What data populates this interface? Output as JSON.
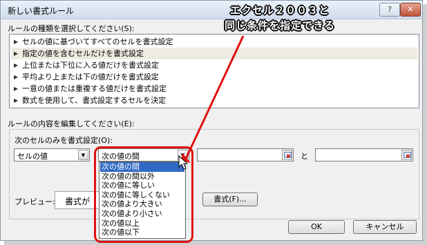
{
  "window": {
    "title": "新しい書式ルール",
    "help_btn": "?",
    "close_btn": "✕"
  },
  "rule_type": {
    "label": "ルールの種類を選択してください(S):",
    "items": [
      "セルの値に基づいてすべてのセルを書式設定",
      "指定の値を含むセルだけを書式設定",
      "上位または下位に入る値だけを書式設定",
      "平均より上または下の値だけを書式設定",
      "一意の値または重複する値だけを書式設定",
      "数式を使用して、書式設定するセルを決定"
    ],
    "selected_index": 1
  },
  "rule_edit": {
    "label": "ルールの内容を編集してください(E):",
    "sub_label": "次のセルのみを書式設定(O):",
    "combo1_value": "セルの値",
    "combo2_value": "次の値の間",
    "and_label": "と",
    "preview_label": "プレビュー:",
    "preview_text": "書式が",
    "format_button": "書式(F)..."
  },
  "dropdown": {
    "options": [
      "次の値の間",
      "次の値の間以外",
      "次の値に等しい",
      "次の値に等しくない",
      "次の値より大きい",
      "次の値より小さい",
      "次の値以上",
      "次の値以下"
    ],
    "selected_index": 0
  },
  "buttons": {
    "ok": "OK",
    "cancel": "キャンセル"
  },
  "annotation": {
    "line1": "エクセル２００３と",
    "line2": "同じ条件を指定できる"
  },
  "colors": {
    "highlight": "#e01010",
    "selection": "#316ac5",
    "list_selected": "#efebe3"
  }
}
